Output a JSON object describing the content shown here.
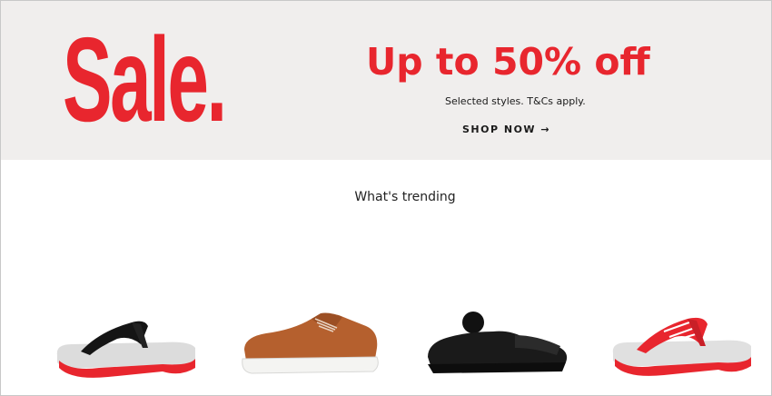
{
  "banner": {
    "sale_word": "Sale.",
    "headline": "Up to 50% off",
    "terms": "Selected styles. T&Cs apply.",
    "cta": "SHOP NOW →"
  },
  "trending": {
    "title": "What's trending"
  },
  "colors": {
    "brand_red": "#e8262e",
    "banner_bg": "#f0eeed"
  }
}
